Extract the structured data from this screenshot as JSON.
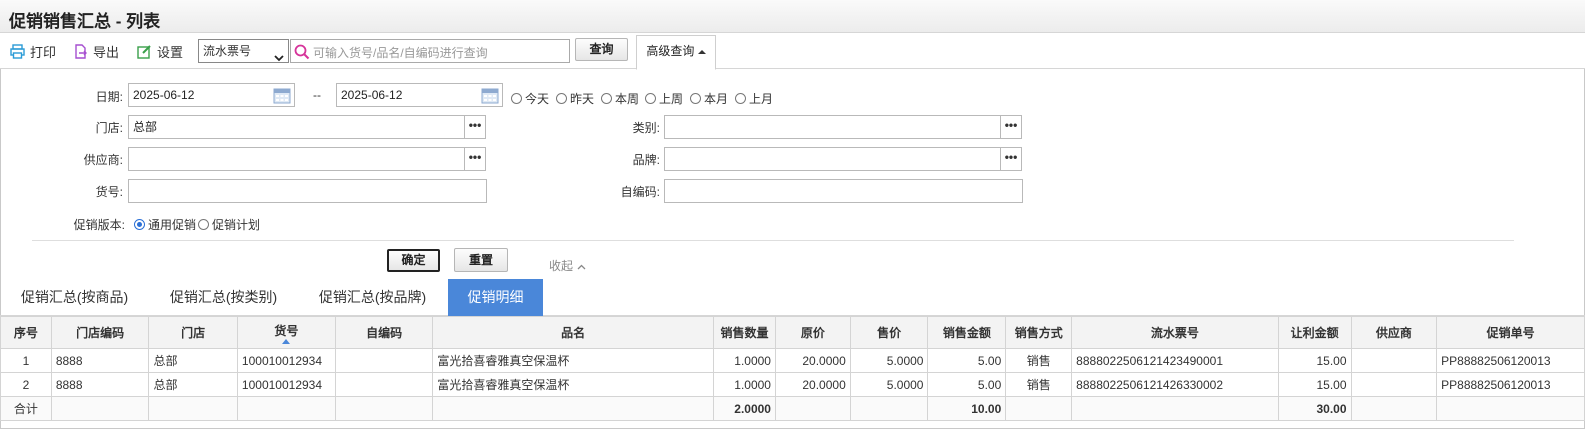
{
  "title": "促销销售汇总 - 列表",
  "toolbar": {
    "print_label": "打印",
    "export_label": "导出",
    "settings_label": "设置",
    "search_field_selected": "流水票号",
    "search_placeholder": "可输入货号/品名/自编码进行查询",
    "query_label": "查询",
    "advanced_label": "高级查询"
  },
  "filters": {
    "date_label": "日期:",
    "date_from": "2025-06-12",
    "date_sep": "--",
    "date_to": "2025-06-12",
    "quick_dates": [
      "今天",
      "昨天",
      "本周",
      "上周",
      "本月",
      "上月"
    ],
    "store_label": "门店:",
    "store_value": "总部",
    "category_label": "类别:",
    "category_value": "",
    "supplier_label": "供应商:",
    "supplier_value": "",
    "brand_label": "品牌:",
    "brand_value": "",
    "sku_label": "货号:",
    "sku_value": "",
    "selfcode_label": "自编码:",
    "selfcode_value": "",
    "version_label": "促销版本:",
    "version_options": [
      "通用促销",
      "促销计划"
    ],
    "version_selected": "通用促销",
    "confirm_label": "确定",
    "reset_label": "重置",
    "collapse_label": "收起"
  },
  "tabs": [
    {
      "label": "促销汇总(按商品)",
      "active": false
    },
    {
      "label": "促销汇总(按类别)",
      "active": false
    },
    {
      "label": "促销汇总(按品牌)",
      "active": false
    },
    {
      "label": "促销明细",
      "active": true
    }
  ],
  "table": {
    "headers": [
      "序号",
      "门店编码",
      "门店",
      "货号",
      "自编码",
      "品名",
      "销售数量",
      "原价",
      "售价",
      "销售金额",
      "销售方式",
      "流水票号",
      "让利金额",
      "供应商",
      "促销单号"
    ],
    "rows": [
      [
        "1",
        "8888",
        "总部",
        "100010012934",
        "",
        "富光拾喜睿雅真空保温杯",
        "1.0000",
        "20.0000",
        "5.0000",
        "5.00",
        "销售",
        "8888022506121423490001",
        "15.00",
        "",
        "PP88882506120013"
      ],
      [
        "2",
        "8888",
        "总部",
        "100010012934",
        "",
        "富光拾喜睿雅真空保温杯",
        "1.0000",
        "20.0000",
        "5.0000",
        "5.00",
        "销售",
        "8888022506121426330002",
        "15.00",
        "",
        "PP88882506120013"
      ]
    ],
    "summary": [
      "合计",
      "",
      "",
      "",
      "",
      "",
      "2.0000",
      "",
      "",
      "10.00",
      "",
      "",
      "30.00",
      "",
      ""
    ]
  },
  "colors": {
    "accent": "#4a87d9",
    "print_icon": "#2a9bd6",
    "export_icon": "#a64fd0",
    "settings_icon": "#3aa04a",
    "search_icon": "#d6339a"
  }
}
